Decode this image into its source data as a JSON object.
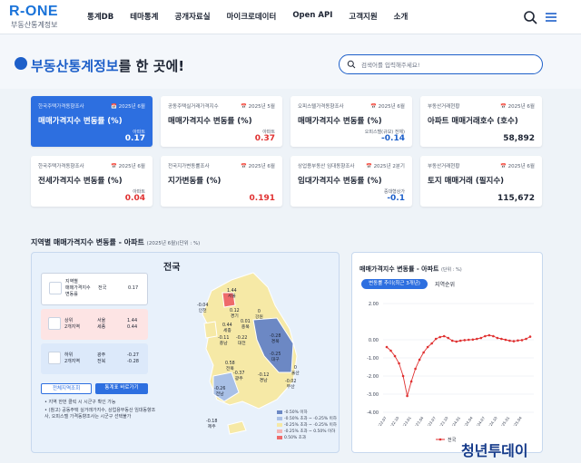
{
  "brand": {
    "logo": "R-ONE",
    "subtitle": "부동산통계정보"
  },
  "nav": {
    "items": [
      "통계DB",
      "테마통계",
      "공개자료실",
      "마이크로데이터",
      "Open API",
      "고객지원",
      "소개"
    ]
  },
  "hero": {
    "title_highlight": "부동산통계정보",
    "title_rest": "를 한 곳에!",
    "search_placeholder": "검색어를 입력해주세요!"
  },
  "cards": [
    {
      "source": "한국주택가격동향조사",
      "period": "2025년 6월",
      "title": "매매가격지수 변동률 (%)",
      "sub": "아파트",
      "value": "0.17",
      "trend": "up",
      "active": true
    },
    {
      "source": "공동주택실거래가격지수",
      "period": "2025년 5월",
      "title": "매매가격지수 변동률 (%)",
      "sub": "아파트",
      "value": "0.37",
      "trend": "up",
      "active": false
    },
    {
      "source": "오피스텔가격동향조사",
      "period": "2025년 6월",
      "title": "매매가격지수 변동률 (%)",
      "sub": "오피스텔(규모) 전체)",
      "value": "-0.14",
      "trend": "down",
      "active": false
    },
    {
      "source": "부동산거래현황",
      "period": "2025년 6월",
      "title": "아파트 매매거래호수 (호수)",
      "sub": "",
      "value": "58,892",
      "trend": "neutral",
      "active": false
    },
    {
      "source": "한국주택가격동향조사",
      "period": "2025년 6월",
      "title": "전세가격지수 변동률 (%)",
      "sub": "아파트",
      "value": "0.04",
      "trend": "up",
      "active": false
    },
    {
      "source": "전국지가변동률조사",
      "period": "2025년 6월",
      "title": "지가변동률 (%)",
      "sub": "",
      "value": "0.191",
      "trend": "up",
      "active": false
    },
    {
      "source": "상업용부동산 임대동향조사",
      "period": "2025년 2분기",
      "title": "임대가격지수 변동률 (%)",
      "sub": "중대형상가",
      "value": "-0.1",
      "trend": "down",
      "active": false
    },
    {
      "source": "부동산거래현황",
      "period": "2025년 6월",
      "title": "토지 매매거래 (필지수)",
      "sub": "",
      "value": "115,672",
      "trend": "neutral",
      "active": false
    }
  ],
  "map_section": {
    "title": "지역별 매매가격지수 변동률 - 아파트",
    "period": "(2025년 6월)(단위 : %)",
    "map_title": "전국",
    "nation_box": {
      "label1": "지역별",
      "label2": "매매가격지수",
      "label3": "변동률",
      "region": "전국",
      "value": "0.17"
    },
    "top_box": {
      "label1": "상위",
      "label2": "2개지역",
      "regions": [
        "서울",
        "세종"
      ],
      "values": [
        "1.44",
        "0.44"
      ]
    },
    "bottom_box": {
      "label1": "하위",
      "label2": "2개지역",
      "regions": [
        "광주",
        "전북"
      ],
      "values": [
        "-0.27",
        "-0.28"
      ]
    },
    "btn_all": "전체지역조회",
    "btn_table": "통계표 바로가기",
    "note1": "• 지역 한번 클릭 시 시군구 확인 가능",
    "note2": "• (참고) 공동주택 실거래가지수, 상업용부동산 임대동향조사, 오피스텔 가격동향조사는 시군구 선택불가",
    "legend": [
      "-0.50% 이하",
      "-0.50% 초과 ~ -0.25% 이하",
      "-0.25% 초과 ~ -0.25% 이하",
      "-0.25% 초과 ~ 0.50% 이하",
      "0.50% 초과"
    ],
    "regions": [
      {
        "name": "서울",
        "value": "1.44"
      },
      {
        "name": "인천",
        "value": "-0.04"
      },
      {
        "name": "경기",
        "value": "0.12"
      },
      {
        "name": "강원",
        "value": "0"
      },
      {
        "name": "충북",
        "value": "0.01"
      },
      {
        "name": "세종",
        "value": "0.44"
      },
      {
        "name": "충남",
        "value": "-0.11"
      },
      {
        "name": "대전",
        "value": "-0.22"
      },
      {
        "name": "경북",
        "value": "-0.28"
      },
      {
        "name": "전북",
        "value": "0.58"
      },
      {
        "name": "대구",
        "value": "-0.25"
      },
      {
        "name": "광주",
        "value": "-0.37"
      },
      {
        "name": "울산",
        "value": "0"
      },
      {
        "name": "경남",
        "value": "-0.12"
      },
      {
        "name": "부산",
        "value": "-0.02"
      },
      {
        "name": "전남",
        "value": "-0.26"
      },
      {
        "name": "제주",
        "value": "-0.18"
      }
    ]
  },
  "chart_section": {
    "title": "매매가격지수 변동률 - 아파트",
    "unit": "(단위 : %)",
    "pill": "변동률 추이(최근 3개년)",
    "pill2": "지역순위"
  },
  "chart_data": {
    "type": "line",
    "ylim": [
      -4.0,
      2.0
    ],
    "yticks": [
      "2.00",
      "0.00",
      "-1.00",
      "-2.00",
      "-3.00",
      "-4.00"
    ],
    "yticks_values": [
      2.0,
      0.0,
      -1.0,
      -2.0,
      -3.0,
      -4.0
    ],
    "x": [
      "'22.07",
      "'22.08",
      "'22.09",
      "'22.10",
      "'22.11",
      "'22.12",
      "'23.01",
      "'23.02",
      "'23.03",
      "'23.04",
      "'23.05",
      "'23.06",
      "'23.07",
      "'23.08",
      "'23.09",
      "'23.10",
      "'23.11",
      "'23.12",
      "'24.01",
      "'24.02",
      "'24.03",
      "'24.04",
      "'24.05",
      "'24.06",
      "'24.07",
      "'24.08",
      "'24.09",
      "'24.10",
      "'24.11",
      "'24.12",
      "'25.01",
      "'25.02",
      "'25.03",
      "'25.04",
      "'25.05",
      "'25.06"
    ],
    "series": [
      {
        "name": "전국",
        "values": [
          -0.4,
          -0.6,
          -0.9,
          -1.3,
          -2.0,
          -3.1,
          -2.3,
          -1.6,
          -1.1,
          -0.7,
          -0.4,
          -0.2,
          0.05,
          0.15,
          0.2,
          0.1,
          -0.05,
          -0.1,
          -0.05,
          -0.02,
          0.0,
          0.01,
          0.05,
          0.1,
          0.2,
          0.25,
          0.2,
          0.1,
          0.05,
          0.0,
          -0.05,
          -0.08,
          -0.04,
          -0.02,
          0.05,
          0.17
        ]
      }
    ],
    "xtick_labels": [
      "'22.07",
      "'22.10",
      "'23.01",
      "'23.04",
      "'23.07",
      "'23.10",
      "'24.01",
      "'24.04",
      "'24.07",
      "'24.10",
      "'25.01",
      "'25.04"
    ]
  },
  "watermark": "청년투데이",
  "colors": {
    "accent": "#2d6fe0",
    "up": "#e03131",
    "down": "#1d5fc9"
  }
}
